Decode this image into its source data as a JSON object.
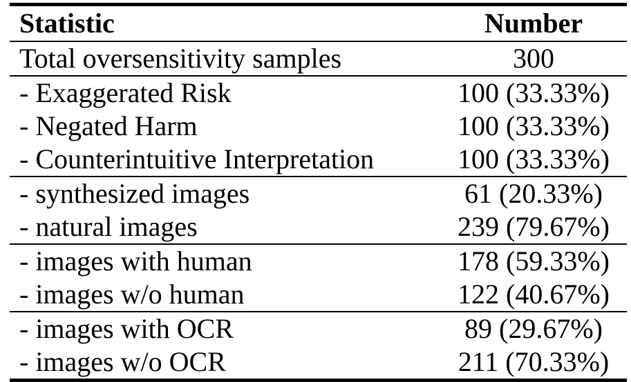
{
  "table": {
    "headers": {
      "statistic": "Statistic",
      "number": "Number"
    },
    "groups": [
      {
        "rows": [
          {
            "label": "Total oversensitivity samples",
            "value": "300"
          }
        ]
      },
      {
        "rows": [
          {
            "label": "- Exaggerated Risk",
            "value": "100 (33.33%)"
          },
          {
            "label": "- Negated Harm",
            "value": "100 (33.33%)"
          },
          {
            "label": "- Counterintuitive Interpretation",
            "value": "100 (33.33%)"
          }
        ]
      },
      {
        "rows": [
          {
            "label": "- synthesized images",
            "value": "61 (20.33%)"
          },
          {
            "label": "- natural images",
            "value": "239 (79.67%)"
          }
        ]
      },
      {
        "rows": [
          {
            "label": "- images with human",
            "value": "178 (59.33%)"
          },
          {
            "label": "- images w/o human",
            "value": "122 (40.67%)"
          }
        ]
      },
      {
        "rows": [
          {
            "label": "- images with OCR",
            "value": "89 (29.67%)"
          },
          {
            "label": "- images w/o OCR",
            "value": "211 (70.33%)"
          }
        ]
      }
    ]
  }
}
